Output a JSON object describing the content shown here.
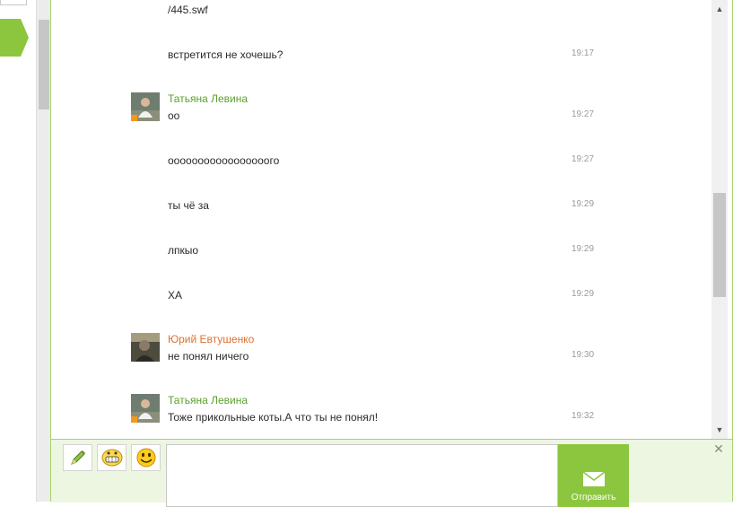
{
  "messages": [
    {
      "text": "/445.swf",
      "time": ""
    },
    {
      "text": "встретится не хочешь?",
      "time": "19:17"
    },
    {
      "author": "Татьяна Левина",
      "author_color": "#5aa02c",
      "text": "оо",
      "time": "19:27"
    },
    {
      "text": "ооооооооооооооооого",
      "time": "19:27"
    },
    {
      "text": "ты чё за",
      "time": "19:29"
    },
    {
      "text": "лпкыо",
      "time": "19:29"
    },
    {
      "text": "ХА",
      "time": "19:29"
    },
    {
      "author": "Юрий Евтушенко",
      "author_color": "#e07030",
      "text": "не понял ничего",
      "time": "19:30"
    },
    {
      "author": "Татьяна Левина",
      "author_color": "#5aa02c",
      "text": "Тоже прикольные коты.А что ты не понял!",
      "time": "19:32"
    }
  ],
  "compose": {
    "input_value": "",
    "send_label": "Отправить",
    "tools": [
      "pencil-icon",
      "grin-smiley-icon",
      "smiley-icon"
    ]
  },
  "colors": {
    "accent": "#8cc63f",
    "border": "#a4d36a",
    "author_green": "#5aa02c",
    "author_orange": "#e07030",
    "compose_bg": "#edf6e1"
  },
  "scrollbar": {
    "chat_scroll_position": 0.51
  }
}
